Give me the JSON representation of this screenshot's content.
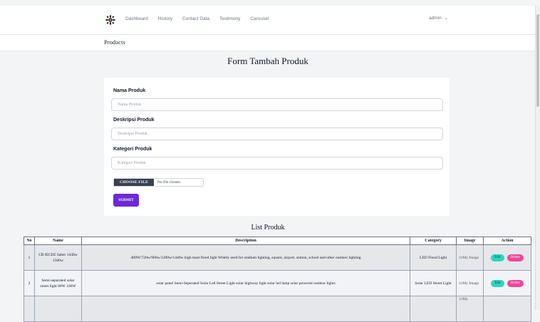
{
  "nav": {
    "logo_icon": "gear-flower-icon",
    "items": [
      "Dashboard",
      "History",
      "Contact Data",
      "Testimony",
      "Carousel"
    ],
    "user": "admin"
  },
  "page": {
    "heading": "Products"
  },
  "form": {
    "title": "Form Tambah Produk",
    "fields": [
      {
        "label": "Nama Produk",
        "placeholder": "Nama Produk"
      },
      {
        "label": "Deskripsi Produk",
        "placeholder": "Deskripsi Produk"
      },
      {
        "label": "Kategori Produk",
        "placeholder": "Kategori Produk"
      }
    ],
    "file_button": "CHOOSE FILE",
    "file_status": "No file chosen",
    "submit_label": "SUBMIT"
  },
  "list": {
    "title": "List Produk",
    "headers": [
      "No",
      "Name",
      "Description",
      "Category",
      "Image",
      "Action"
    ],
    "rows": [
      {
        "no": "1",
        "name": "CB IECEE Saber 1440w 1500w",
        "description": "480W/720w/960w/1200w/1440w high mast flood light Widely used for stadium lighting, square, airport, station, school and other outdoor lighting",
        "category": "LED Flood Light",
        "image_alt": "My Image",
        "edit": "Edit",
        "delete": "Delete"
      },
      {
        "no": "2",
        "name": "Semi-separated solar street light 80W 100W",
        "description": "solar panel Semi-Seperated Solar Led Street Light solar highway light solar led lamp solar powered outdoor lights",
        "category": "Solar LED Street Light",
        "image_alt": "My Image",
        "edit": "Edit",
        "delete": "Delete"
      },
      {
        "no": "",
        "name": "",
        "description": "",
        "category": "",
        "image_alt": "My",
        "edit": "",
        "delete": ""
      }
    ]
  }
}
